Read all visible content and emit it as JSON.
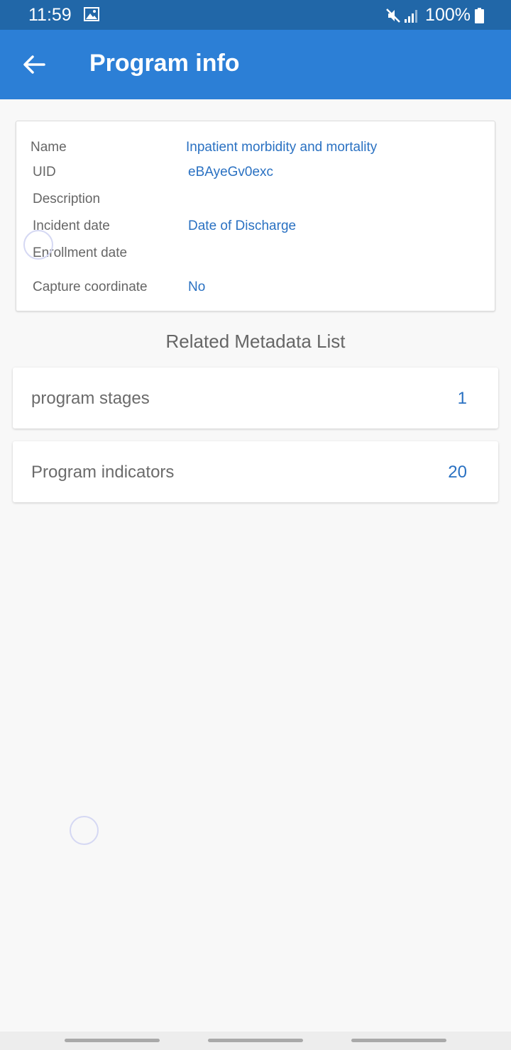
{
  "status_bar": {
    "time": "11:59",
    "battery": "100%"
  },
  "app_bar": {
    "title": "Program info",
    "back_icon": "arrow-back-icon"
  },
  "info": {
    "name_label": "Name",
    "name_value": "Inpatient morbidity and mortality",
    "uid_label": "UID",
    "uid_value": "eBAyeGv0exc",
    "description_label": "Description",
    "description_value": "",
    "incident_date_label": "Incident date",
    "incident_date_value": "Date of Discharge",
    "enrollment_date_label": "Enrollment date",
    "enrollment_date_value": "",
    "capture_coordinate_label": "Capture coordinate",
    "capture_coordinate_value": "No"
  },
  "related": {
    "title": "Related Metadata List",
    "items": [
      {
        "label": "program stages",
        "count": "1"
      },
      {
        "label": "Program indicators",
        "count": "20"
      }
    ]
  },
  "colors": {
    "status_bar": "#2167a8",
    "app_bar": "#2c7fd6",
    "accent_text": "#2a71c2",
    "background": "#f8f8f8"
  }
}
